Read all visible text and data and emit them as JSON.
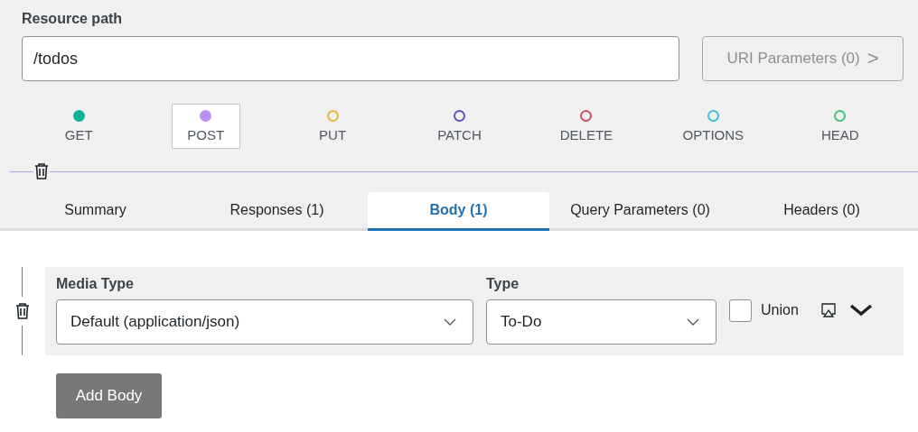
{
  "resource_path": {
    "label": "Resource path",
    "value": "/todos"
  },
  "uri_parameters_button": {
    "label": "URI Parameters (0)",
    "icon": ">"
  },
  "methods": [
    {
      "label": "GET",
      "color": "#12b097",
      "active": true,
      "selected": false
    },
    {
      "label": "POST",
      "color": "#bb8ff7",
      "active": true,
      "selected": true
    },
    {
      "label": "PUT",
      "color": "#e6b73a",
      "active": false,
      "selected": false
    },
    {
      "label": "PATCH",
      "color": "#5b51c7",
      "active": false,
      "selected": false
    },
    {
      "label": "DELETE",
      "color": "#d9485f",
      "active": false,
      "selected": false
    },
    {
      "label": "OPTIONS",
      "color": "#3bbfd6",
      "active": false,
      "selected": false
    },
    {
      "label": "HEAD",
      "color": "#3fc27a",
      "active": false,
      "selected": false
    }
  ],
  "tabs": [
    {
      "label": "Summary",
      "selected": false
    },
    {
      "label": "Responses (1)",
      "selected": false
    },
    {
      "label": "Body (1)",
      "selected": true
    },
    {
      "label": "Query Parameters (0)",
      "selected": false
    },
    {
      "label": "Headers (0)",
      "selected": false
    }
  ],
  "body": {
    "media_type": {
      "label": "Media Type",
      "value": "Default (application/json)"
    },
    "type": {
      "label": "Type",
      "value": "To-Do"
    },
    "union": {
      "label": "Union",
      "checked": false
    }
  },
  "add_body_button": "Add Body"
}
